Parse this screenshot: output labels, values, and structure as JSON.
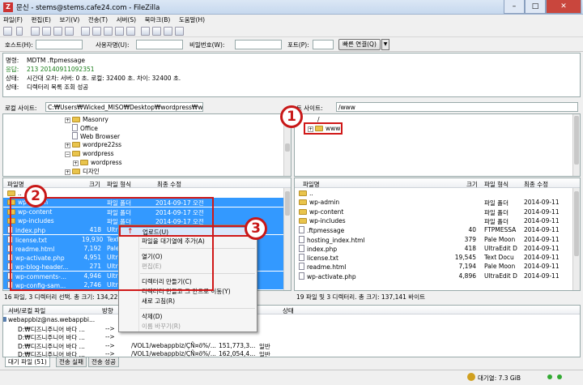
{
  "window": {
    "title": "문신 - stems@stems.cafe24.com - FileZilla"
  },
  "menu": [
    "파일(F)",
    "편집(E)",
    "보기(V)",
    "전송(T)",
    "서버(S)",
    "북마크(B)",
    "도움말(H)"
  ],
  "quickconnect": {
    "host_label": "호스트(H):",
    "user_label": "사용자명(U):",
    "pass_label": "비밀번호(W):",
    "port_label": "포트(P):",
    "connect_button": "빠른 연결(Q)"
  },
  "log": [
    {
      "key": "명령:",
      "text": "MDTM .ftpmessage",
      "color": "#000000"
    },
    {
      "key": "응답:",
      "text": "213 20140911092351",
      "color": "#1a7d1a"
    },
    {
      "key": "상태:",
      "text": "시간대 오차: 서버: 0 초. 로컬: 32400 초. 차이: 32400 초.",
      "color": "#000000"
    },
    {
      "key": "상태:",
      "text": "디렉터리 목록 조회 성공",
      "color": "#000000"
    }
  ],
  "local": {
    "site_label": "로컬 사이트:",
    "path": "C:₩Users₩Wicked_MISO₩Desktop₩wordpress₩wordpress₩",
    "tree": [
      {
        "name": "Masonry",
        "type": "folder",
        "indent": 1
      },
      {
        "name": "Office",
        "type": "file",
        "indent": 1
      },
      {
        "name": "Web Browser",
        "type": "file",
        "indent": 1
      },
      {
        "name": "wordpre22ss",
        "type": "folder",
        "indent": 1
      },
      {
        "name": "wordpress",
        "type": "folder",
        "indent": 1
      },
      {
        "name": "wordpress",
        "type": "folder",
        "indent": 2
      },
      {
        "name": "디자인",
        "type": "folder",
        "indent": 1
      }
    ],
    "columns": {
      "name": "파일명",
      "size": "크기",
      "type": "파일 형식",
      "modified": "최종 수정"
    },
    "files": [
      {
        "name": "..",
        "size": "",
        "type": "",
        "modified": "",
        "selected": false,
        "kind": "folder"
      },
      {
        "name": "wp-admin",
        "size": "",
        "type": "파일 폴더",
        "modified": "2014-09-17 오전",
        "selected": true,
        "kind": "folder"
      },
      {
        "name": "wp-content",
        "size": "",
        "type": "파일 폴더",
        "modified": "2014-09-17 오전",
        "selected": true,
        "kind": "folder"
      },
      {
        "name": "wp-includes",
        "size": "",
        "type": "파일 폴더",
        "modified": "2014-09-17 오전",
        "selected": true,
        "kind": "folder"
      },
      {
        "name": "index.php",
        "size": "418",
        "type": "UltraEd",
        "modified": "",
        "selected": true,
        "kind": "file"
      },
      {
        "name": "license.txt",
        "size": "19,930",
        "type": "Text Do",
        "modified": "",
        "selected": true,
        "kind": "file"
      },
      {
        "name": "readme.html",
        "size": "7,192",
        "type": "Pale M",
        "modified": "",
        "selected": true,
        "kind": "file"
      },
      {
        "name": "wp-activate.php",
        "size": "4,951",
        "type": "UltraEd",
        "modified": "",
        "selected": true,
        "kind": "file"
      },
      {
        "name": "wp-blog-header...",
        "size": "271",
        "type": "UltraEd",
        "modified": "",
        "selected": true,
        "kind": "file"
      },
      {
        "name": "wp-comments-...",
        "size": "4,946",
        "type": "UltraEd",
        "modified": "",
        "selected": true,
        "kind": "file"
      },
      {
        "name": "wp-config-sam...",
        "size": "2,746",
        "type": "UltraEd",
        "modified": "",
        "selected": true,
        "kind": "file"
      }
    ],
    "status": "16 파일, 3 디렉터리 선택. 총 크기: 134,228"
  },
  "remote": {
    "site_label": "트 사이트:",
    "path": "/www",
    "tree": [
      {
        "name": "/",
        "type": "root"
      },
      {
        "name": "www",
        "type": "folder"
      }
    ],
    "columns": {
      "name": "파일명",
      "size": "크기",
      "type": "파일 형식",
      "modified": "최종 수정"
    },
    "files": [
      {
        "name": "..",
        "size": "",
        "type": "",
        "modified": "",
        "kind": "folder"
      },
      {
        "name": "wp-admin",
        "size": "",
        "type": "파일 폴더",
        "modified": "2014-09-11",
        "kind": "folder"
      },
      {
        "name": "wp-content",
        "size": "",
        "type": "파일 폴더",
        "modified": "2014-09-11",
        "kind": "folder"
      },
      {
        "name": "wp-includes",
        "size": "",
        "type": "파일 폴더",
        "modified": "2014-09-11",
        "kind": "folder"
      },
      {
        "name": ".ftpmessage",
        "size": "40",
        "type": "FTPMESSA",
        "modified": "2014-09-11",
        "kind": "file"
      },
      {
        "name": "hosting_index.html",
        "size": "379",
        "type": "Pale Moon",
        "modified": "2014-09-11",
        "kind": "file"
      },
      {
        "name": "index.php",
        "size": "418",
        "type": "UltraEdit D",
        "modified": "2014-09-11",
        "kind": "file"
      },
      {
        "name": "license.txt",
        "size": "19,545",
        "type": "Text Docu",
        "modified": "2014-09-11",
        "kind": "file"
      },
      {
        "name": "readme.html",
        "size": "7,194",
        "type": "Pale Moon",
        "modified": "2014-09-11",
        "kind": "file"
      },
      {
        "name": "wp-activate.php",
        "size": "4,896",
        "type": "UltraEdit D",
        "modified": "2014-09-11",
        "kind": "file"
      }
    ],
    "status": "19 파일 및 3 디렉터리. 총 크기: 137,141 바이트"
  },
  "context_menu": {
    "items": [
      {
        "label": "업로드(U)",
        "highlighted": true,
        "disabled": false
      },
      {
        "label": "파일을 대기열에 추가(A)",
        "highlighted": false,
        "disabled": false
      },
      {
        "label": "열기(O)",
        "highlighted": false,
        "disabled": false
      },
      {
        "label": "편집(E)",
        "highlighted": false,
        "disabled": true
      },
      {
        "label": "디렉터리 만들기(C)",
        "highlighted": false,
        "disabled": false
      },
      {
        "label": "디렉터리 만들고 그 안으로 이동(Y)",
        "highlighted": false,
        "disabled": false
      },
      {
        "label": "새로 고침(R)",
        "highlighted": false,
        "disabled": false
      },
      {
        "label": "삭제(D)",
        "highlighted": false,
        "disabled": false
      },
      {
        "label": "이름 바꾸기(R)",
        "highlighted": false,
        "disabled": true
      }
    ]
  },
  "queue": {
    "columns": {
      "file": "서버/로컬 파일",
      "direction": "방향",
      "status": "상태"
    },
    "rows": [
      {
        "local": "webappbiz@nas.webappbi...",
        "dir": "",
        "remote": "",
        "size": "",
        "state": "",
        "server": true
      },
      {
        "local": "D:₩디즈니주니어 바다 ...",
        "dir": "-->",
        "remote": "",
        "size": "",
        "state": "",
        "server": false
      },
      {
        "local": "D:₩디즈니주니어 바다 ...",
        "dir": "-->",
        "remote": "",
        "size": "",
        "state": "",
        "server": false
      },
      {
        "local": "D:₩디즈니주니어 바다 ...",
        "dir": "-->",
        "remote": "/VOL1/webappbiz/ÇÑ¤ö%/...",
        "size": "151,773,3...",
        "state": "일반",
        "server": false
      },
      {
        "local": "D:₩디즈니주니어 바다 ...",
        "dir": "-->",
        "remote": "/VOL1/webappbiz/ÇÑ¤ö%/...",
        "size": "162,054,4...",
        "state": "일반",
        "server": false
      },
      {
        "local": "D:₩디즈니주니어 바다 ...",
        "dir": "-->",
        "remote": "/VOL1/webappbiz/ÇÑ¤ö%/...",
        "size": "",
        "state": "일반",
        "server": false
      }
    ]
  },
  "tabs": [
    "대기 파일 (51)",
    "전송 실패",
    "전송 성공"
  ],
  "statusbar": {
    "queue_size": "대기열: 7.3 GiB"
  },
  "annotations": [
    "1",
    "2",
    "3"
  ]
}
